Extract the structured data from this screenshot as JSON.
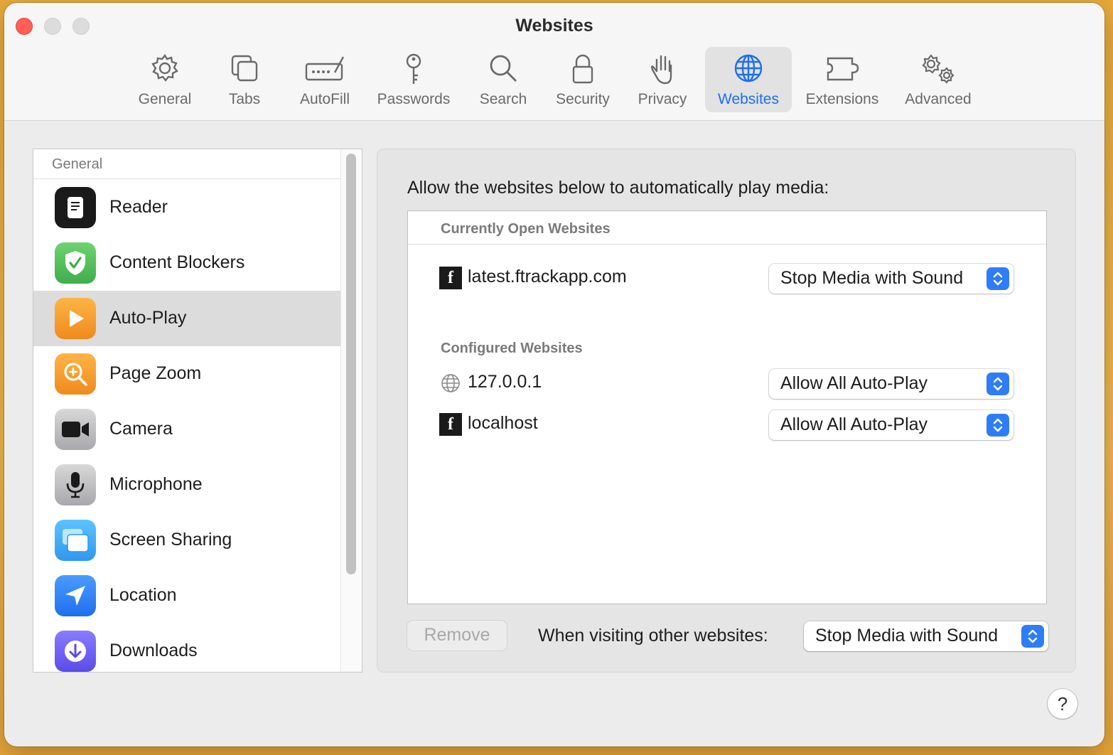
{
  "window": {
    "title": "Websites"
  },
  "toolbar": {
    "items": [
      {
        "label": "General",
        "icon": "gear-icon"
      },
      {
        "label": "Tabs",
        "icon": "tabs-icon"
      },
      {
        "label": "AutoFill",
        "icon": "autofill-icon"
      },
      {
        "label": "Passwords",
        "icon": "key-icon"
      },
      {
        "label": "Search",
        "icon": "magnifier-icon"
      },
      {
        "label": "Security",
        "icon": "lock-icon"
      },
      {
        "label": "Privacy",
        "icon": "hand-icon"
      },
      {
        "label": "Websites",
        "icon": "globe-icon",
        "selected": true
      },
      {
        "label": "Extensions",
        "icon": "puzzle-icon"
      },
      {
        "label": "Advanced",
        "icon": "gears-icon"
      }
    ],
    "accent": "#1e6ef0"
  },
  "sidebar": {
    "header": "General",
    "items": [
      {
        "label": "Reader",
        "icon": "reader-icon",
        "color": "#1a1a1a"
      },
      {
        "label": "Content Blockers",
        "icon": "shield-check-icon",
        "color": "#4cc45a"
      },
      {
        "label": "Auto-Play",
        "icon": "play-icon",
        "color": "#f5a028",
        "selected": true
      },
      {
        "label": "Page Zoom",
        "icon": "zoom-icon",
        "color": "#f5a028"
      },
      {
        "label": "Camera",
        "icon": "camera-icon",
        "color": "#8e8e93"
      },
      {
        "label": "Microphone",
        "icon": "microphone-icon",
        "color": "#8e8e93"
      },
      {
        "label": "Screen Sharing",
        "icon": "screen-sharing-icon",
        "color": "#3aa6f5"
      },
      {
        "label": "Location",
        "icon": "location-arrow-icon",
        "color": "#2f7df6"
      },
      {
        "label": "Downloads",
        "icon": "download-icon",
        "color": "#6a5cf0"
      }
    ]
  },
  "main": {
    "title": "Allow the websites below to automatically play media:",
    "open_header": "Currently Open Websites",
    "open_sites": [
      {
        "name": "latest.ftrackapp.com",
        "icon": "f-favicon-icon",
        "setting": "Stop Media with Sound"
      }
    ],
    "configured_header": "Configured Websites",
    "configured_sites": [
      {
        "name": "127.0.0.1",
        "icon": "globe-icon",
        "setting": "Allow All Auto-Play"
      },
      {
        "name": "localhost",
        "icon": "f-favicon-icon",
        "setting": "Allow All Auto-Play"
      }
    ],
    "remove_label": "Remove",
    "other_label": "When visiting other websites:",
    "other_setting": "Stop Media with Sound",
    "help_label": "?"
  }
}
